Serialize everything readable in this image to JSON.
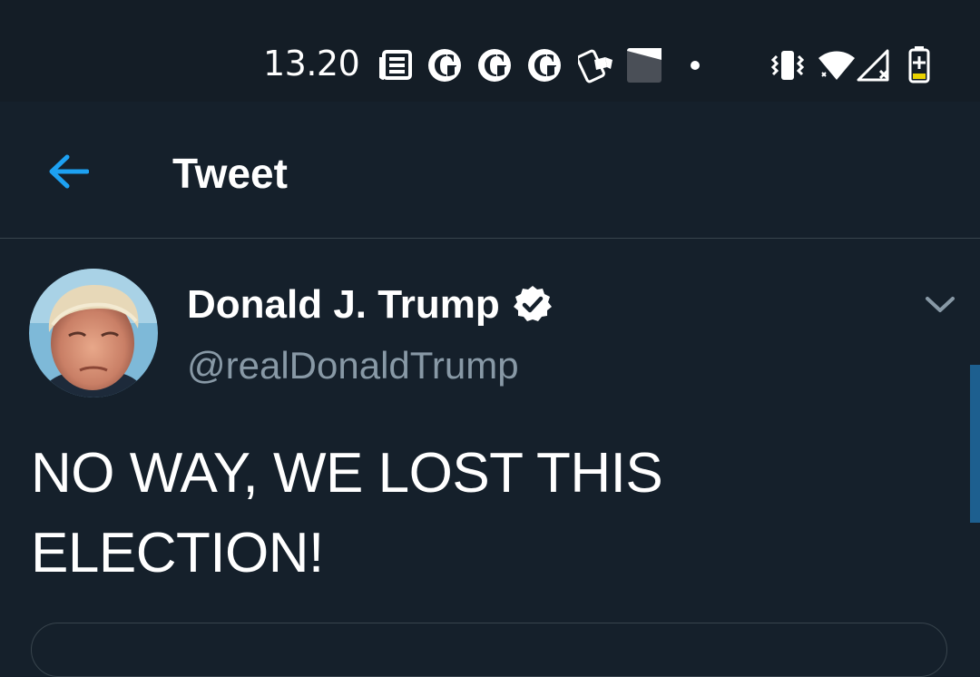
{
  "status_bar": {
    "time": "13.20",
    "icons": [
      "news-icon",
      "guardian-icon",
      "guardian-icon",
      "guardian-icon",
      "phone-flag-icon",
      "image-icon",
      "dot-icon",
      "vibrate-icon",
      "wifi-icon",
      "signal-icon",
      "battery-charging-icon"
    ]
  },
  "header": {
    "title": "Tweet",
    "back_icon": "arrow-left-icon"
  },
  "tweet": {
    "display_name": "Donald J. Trump",
    "handle": "@realDonaldTrump",
    "verified": true,
    "text_line1": "NO WAY, WE LOST THIS",
    "text_line2": "ELECTION!",
    "more_icon": "chevron-down-icon"
  },
  "colors": {
    "background": "#15202b",
    "status_bar": "#141d26",
    "accent": "#1da1f2",
    "secondary_text": "#8899a6",
    "divider": "#38444d"
  }
}
